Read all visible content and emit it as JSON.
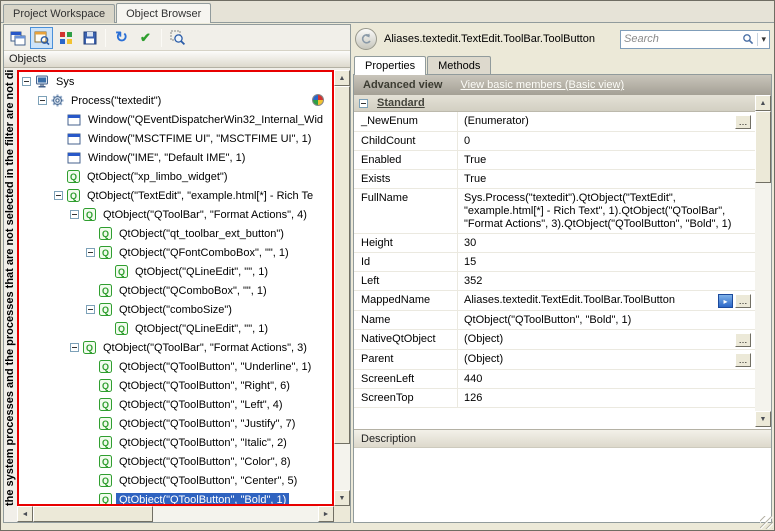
{
  "tabs": {
    "items": [
      {
        "label": "Project Workspace",
        "active": false
      },
      {
        "label": "Object Browser",
        "active": true
      }
    ]
  },
  "left_panel": {
    "objects_header": "Objects",
    "vertical_note": "the system processes and the processes that are not selected in the filter are not di",
    "toolbar_icons": [
      "panels-icon",
      "highlight-object-icon",
      "map-object-icon",
      "store-object-icon",
      "refresh-icon",
      "check-object-icon",
      "find-object-icon"
    ],
    "tree": [
      {
        "level": 0,
        "icon": "computer",
        "expander": "minus",
        "label": "Sys"
      },
      {
        "level": 1,
        "icon": "process",
        "expander": "minus",
        "label": "Process(\"textedit\")"
      },
      {
        "level": 2,
        "icon": "window",
        "expander": "none",
        "label": "Window(\"QEventDispatcherWin32_Internal_Wid"
      },
      {
        "level": 2,
        "icon": "window",
        "expander": "none",
        "label": "Window(\"MSCTFIME UI\", \"MSCTFIME UI\", 1)"
      },
      {
        "level": 2,
        "icon": "window",
        "expander": "none",
        "label": "Window(\"IME\", \"Default IME\", 1)"
      },
      {
        "level": 2,
        "icon": "qt",
        "expander": "none",
        "label": "QtObject(\"xp_limbo_widget\")"
      },
      {
        "level": 2,
        "icon": "qt",
        "expander": "minus",
        "label": "QtObject(\"TextEdit\", \"example.html[*] - Rich Te"
      },
      {
        "level": 3,
        "icon": "qt",
        "expander": "minus",
        "label": "QtObject(\"QToolBar\", \"Format Actions\", 4)"
      },
      {
        "level": 4,
        "icon": "qt",
        "expander": "none",
        "label": "QtObject(\"qt_toolbar_ext_button\")"
      },
      {
        "level": 4,
        "icon": "qt",
        "expander": "minus",
        "label": "QtObject(\"QFontComboBox\", \"\", 1)"
      },
      {
        "level": 5,
        "icon": "qt",
        "expander": "none",
        "label": "QtObject(\"QLineEdit\", \"\", 1)"
      },
      {
        "level": 4,
        "icon": "qt",
        "expander": "none",
        "label": "QtObject(\"QComboBox\", \"\", 1)"
      },
      {
        "level": 4,
        "icon": "qt",
        "expander": "minus",
        "label": "QtObject(\"comboSize\")"
      },
      {
        "level": 5,
        "icon": "qt",
        "expander": "none",
        "label": "QtObject(\"QLineEdit\", \"\", 1)"
      },
      {
        "level": 3,
        "icon": "qt",
        "expander": "minus",
        "label": "QtObject(\"QToolBar\", \"Format Actions\", 3)"
      },
      {
        "level": 4,
        "icon": "qt",
        "expander": "none",
        "label": "QtObject(\"QToolButton\", \"Underline\", 1)"
      },
      {
        "level": 4,
        "icon": "qt",
        "expander": "none",
        "label": "QtObject(\"QToolButton\", \"Right\", 6)"
      },
      {
        "level": 4,
        "icon": "qt",
        "expander": "none",
        "label": "QtObject(\"QToolButton\", \"Left\", 4)"
      },
      {
        "level": 4,
        "icon": "qt",
        "expander": "none",
        "label": "QtObject(\"QToolButton\", \"Justify\", 7)"
      },
      {
        "level": 4,
        "icon": "qt",
        "expander": "none",
        "label": "QtObject(\"QToolButton\", \"Italic\", 2)"
      },
      {
        "level": 4,
        "icon": "qt",
        "expander": "none",
        "label": "QtObject(\"QToolButton\", \"Color\", 8)"
      },
      {
        "level": 4,
        "icon": "qt",
        "expander": "none",
        "label": "QtObject(\"QToolButton\", \"Center\", 5)"
      },
      {
        "level": 4,
        "icon": "qt",
        "expander": "none",
        "label": "QtObject(\"QToolButton\", \"Bold\", 1)",
        "selected": true
      }
    ]
  },
  "right_panel": {
    "object_path": "Aliases.textedit.TextEdit.ToolBar.ToolButton",
    "search": {
      "placeholder": "Search"
    },
    "tabs": [
      {
        "label": "Properties",
        "active": true
      },
      {
        "label": "Methods",
        "active": false
      }
    ],
    "view_bar": {
      "mode_label": "Advanced view",
      "link_label": "View basic members (Basic view)"
    },
    "group_header": "Standard",
    "properties": [
      {
        "name": "_NewEnum",
        "value": "(Enumerator)",
        "buttons": [
          "ellipsis"
        ]
      },
      {
        "name": "ChildCount",
        "value": "0"
      },
      {
        "name": "Enabled",
        "value": "True"
      },
      {
        "name": "Exists",
        "value": "True"
      },
      {
        "name": "FullName",
        "value": "Sys.Process(\"textedit\").QtObject(\"TextEdit\", \"example.html[*] - Rich Text\", 1).QtObject(\"QToolBar\", \"Format Actions\", 3).QtObject(\"QToolButton\", \"Bold\", 1)"
      },
      {
        "name": "Height",
        "value": "30"
      },
      {
        "name": "Id",
        "value": "15"
      },
      {
        "name": "Left",
        "value": "352"
      },
      {
        "name": "MappedName",
        "value": "Aliases.textedit.TextEdit.ToolBar.ToolButton",
        "buttons": [
          "map",
          "ellipsis"
        ]
      },
      {
        "name": "Name",
        "value": "QtObject(\"QToolButton\", \"Bold\", 1)"
      },
      {
        "name": "NativeQtObject",
        "value": "(Object)",
        "buttons": [
          "ellipsis"
        ]
      },
      {
        "name": "Parent",
        "value": "(Object)",
        "buttons": [
          "ellipsis"
        ]
      },
      {
        "name": "ScreenLeft",
        "value": "440"
      },
      {
        "name": "ScreenTop",
        "value": "126"
      }
    ],
    "description_header": "Description"
  },
  "colors": {
    "selection": "#2f63c0",
    "red_highlight": "#e80000",
    "qt_green": "#2f9e2f",
    "chrome": "#ece9d8"
  }
}
